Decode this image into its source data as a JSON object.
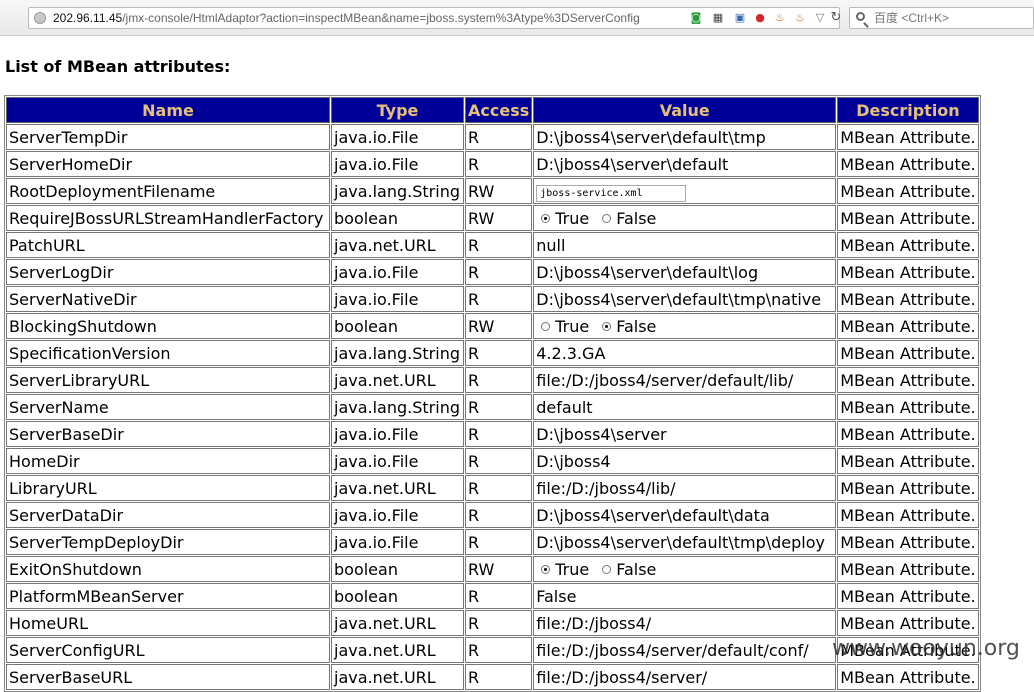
{
  "browser": {
    "url_host": "202.96.11.45",
    "url_path": "/jmx-console/HtmlAdaptor?action=inspectMBean&name=jboss.system%3Atype%3DServerConfig",
    "search_placeholder": "百度 <Ctrl+K>"
  },
  "page": {
    "title": "List of MBean attributes:",
    "watermark": "www.wooyun.org"
  },
  "table": {
    "headers": [
      "Name",
      "Type",
      "Access",
      "Value",
      "Description"
    ],
    "rows": [
      {
        "name": "ServerTempDir",
        "type": "java.io.File",
        "access": "R",
        "value": "D:\\jboss4\\server\\default\\tmp",
        "desc": "MBean Attribute."
      },
      {
        "name": "ServerHomeDir",
        "type": "java.io.File",
        "access": "R",
        "value": "D:\\jboss4\\server\\default",
        "desc": "MBean Attribute."
      },
      {
        "name": "RootDeploymentFilename",
        "type": "java.lang.String",
        "access": "RW",
        "kind": "input",
        "value": "jboss-service.xml",
        "desc": "MBean Attribute."
      },
      {
        "name": "RequireJBossURLStreamHandlerFactory",
        "type": "boolean",
        "access": "RW",
        "kind": "radio",
        "selected": "True",
        "desc": "MBean Attribute."
      },
      {
        "name": "PatchURL",
        "type": "java.net.URL",
        "access": "R",
        "value": "null",
        "desc": "MBean Attribute."
      },
      {
        "name": "ServerLogDir",
        "type": "java.io.File",
        "access": "R",
        "value": "D:\\jboss4\\server\\default\\log",
        "desc": "MBean Attribute."
      },
      {
        "name": "ServerNativeDir",
        "type": "java.io.File",
        "access": "R",
        "value": "D:\\jboss4\\server\\default\\tmp\\native",
        "desc": "MBean Attribute."
      },
      {
        "name": "BlockingShutdown",
        "type": "boolean",
        "access": "RW",
        "kind": "radio",
        "selected": "False",
        "desc": "MBean Attribute."
      },
      {
        "name": "SpecificationVersion",
        "type": "java.lang.String",
        "access": "R",
        "value": "4.2.3.GA",
        "desc": "MBean Attribute."
      },
      {
        "name": "ServerLibraryURL",
        "type": "java.net.URL",
        "access": "R",
        "value": "file:/D:/jboss4/server/default/lib/",
        "desc": "MBean Attribute."
      },
      {
        "name": "ServerName",
        "type": "java.lang.String",
        "access": "R",
        "value": "default",
        "desc": "MBean Attribute."
      },
      {
        "name": "ServerBaseDir",
        "type": "java.io.File",
        "access": "R",
        "value": "D:\\jboss4\\server",
        "desc": "MBean Attribute."
      },
      {
        "name": "HomeDir",
        "type": "java.io.File",
        "access": "R",
        "value": "D:\\jboss4",
        "desc": "MBean Attribute."
      },
      {
        "name": "LibraryURL",
        "type": "java.net.URL",
        "access": "R",
        "value": "file:/D:/jboss4/lib/",
        "desc": "MBean Attribute."
      },
      {
        "name": "ServerDataDir",
        "type": "java.io.File",
        "access": "R",
        "value": "D:\\jboss4\\server\\default\\data",
        "desc": "MBean Attribute."
      },
      {
        "name": "ServerTempDeployDir",
        "type": "java.io.File",
        "access": "R",
        "value": "D:\\jboss4\\server\\default\\tmp\\deploy",
        "desc": "MBean Attribute."
      },
      {
        "name": "ExitOnShutdown",
        "type": "boolean",
        "access": "RW",
        "kind": "radio",
        "selected": "True",
        "desc": "MBean Attribute."
      },
      {
        "name": "PlatformMBeanServer",
        "type": "boolean",
        "access": "R",
        "value": "False",
        "desc": "MBean Attribute."
      },
      {
        "name": "HomeURL",
        "type": "java.net.URL",
        "access": "R",
        "value": "file:/D:/jboss4/",
        "desc": "MBean Attribute."
      },
      {
        "name": "ServerConfigURL",
        "type": "java.net.URL",
        "access": "R",
        "value": "file:/D:/jboss4/server/default/conf/",
        "desc": "MBean Attribute."
      },
      {
        "name": "ServerBaseURL",
        "type": "java.net.URL",
        "access": "R",
        "value": "file:/D:/jboss4/server/",
        "desc": "MBean Attribute."
      }
    ],
    "radio_labels": [
      "True",
      "False"
    ]
  }
}
